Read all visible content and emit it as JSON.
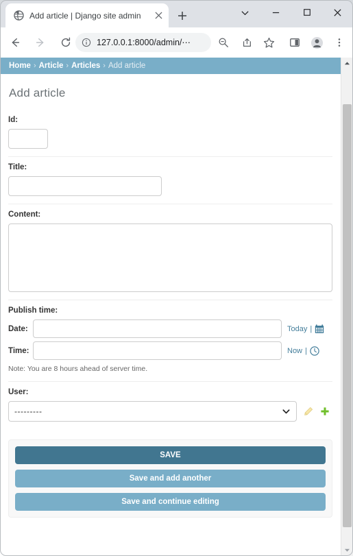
{
  "browser": {
    "tab": {
      "title": "Add article | Django site admin",
      "favicon_name": "globe-icon",
      "close_label": "✕"
    },
    "new_tab_label": "+",
    "window_controls": {
      "tab_search": "⌄",
      "minimize": "–",
      "maximize": "□",
      "close": "✕"
    },
    "toolbar": {
      "back": "←",
      "forward": "→",
      "reload": "⟳",
      "url": "127.0.0.1:8000/admin/⋯",
      "site_info_icon": "info-circle-icon",
      "zoom_icon": "zoom-out-icon",
      "share_icon": "share-icon",
      "bookmark_icon": "star-icon",
      "sidepanel_icon": "side-panel-icon",
      "profile_icon": "profile-avatar-icon",
      "menu_icon": "three-dot-menu-icon"
    }
  },
  "breadcrumbs": {
    "separator": "›",
    "items": [
      {
        "label": "Home",
        "current": false
      },
      {
        "label": "Article",
        "current": false
      },
      {
        "label": "Articles",
        "current": false
      },
      {
        "label": "Add article",
        "current": true
      }
    ]
  },
  "page": {
    "title": "Add article"
  },
  "form": {
    "id": {
      "label": "Id:",
      "value": ""
    },
    "title": {
      "label": "Title:",
      "value": ""
    },
    "content": {
      "label": "Content:",
      "value": ""
    },
    "publish_time": {
      "label": "Publish time:",
      "date": {
        "label": "Date:",
        "value": "",
        "shortcut": "Today",
        "separator": "|",
        "icon": "calendar-icon"
      },
      "time": {
        "label": "Time:",
        "value": "",
        "shortcut": "Now",
        "separator": "|",
        "icon": "clock-icon"
      },
      "note": "Note: You are 8 hours ahead of server time."
    },
    "user": {
      "label": "User:",
      "selected": "---------",
      "options": [
        "---------"
      ],
      "change_icon": "pencil-edit-icon",
      "add_icon": "plus-add-icon"
    }
  },
  "submit_row": {
    "save": "SAVE",
    "save_and_add_another": "Save and add another",
    "save_and_continue": "Save and continue editing"
  },
  "colors": {
    "header_blue": "#79aec8",
    "dark_blue": "#417690",
    "link_blue": "#447e9b",
    "add_green": "#70bf2b",
    "page_bg": "#ffffff"
  },
  "scrollbar": {
    "up_arrow": "▲",
    "down_arrow": "▼"
  }
}
